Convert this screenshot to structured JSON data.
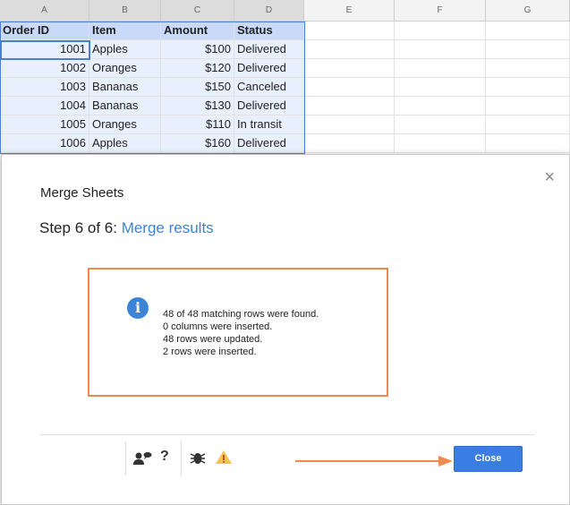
{
  "sheet": {
    "columns": [
      "A",
      "B",
      "C",
      "D",
      "E",
      "F",
      "G"
    ],
    "headers": [
      "Order ID",
      "Item",
      "Amount",
      "Status"
    ],
    "rows": [
      [
        "1001",
        "Apples",
        "$100",
        "Delivered"
      ],
      [
        "1002",
        "Oranges",
        "$120",
        "Delivered"
      ],
      [
        "1003",
        "Bananas",
        "$150",
        "Canceled"
      ],
      [
        "1004",
        "Bananas",
        "$130",
        "Delivered"
      ],
      [
        "1005",
        "Oranges",
        "$110",
        "In transit"
      ],
      [
        "1006",
        "Apples",
        "$160",
        "Delivered"
      ]
    ]
  },
  "dialog": {
    "title": "Merge Sheets",
    "close_x": "×",
    "step_prefix": "Step 6 of 6:",
    "step_name": "Merge results",
    "info_glyph": "i",
    "messages": [
      "48 of 48 matching rows were found.",
      "0 columns were inserted.",
      "48 rows were updated.",
      "2 rows were inserted."
    ],
    "help_glyph": "?",
    "close_label": "Close"
  },
  "colors": {
    "accent": "#3b84d6",
    "highlight_border": "#f0894d",
    "button": "#3a7ee4"
  }
}
